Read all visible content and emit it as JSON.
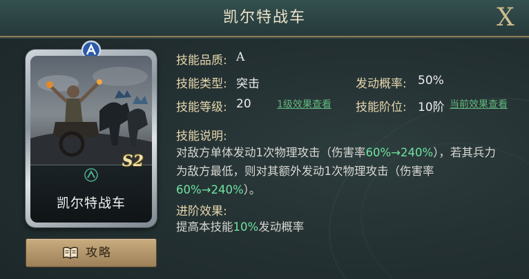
{
  "title": "凯尔特战车",
  "close_label": "X",
  "card": {
    "name": "凯尔特战车",
    "quality_badge": "A",
    "season": "S2"
  },
  "guide_button": {
    "label": "攻略",
    "icon": "book-icon"
  },
  "info": {
    "quality_label": "技能品质:",
    "quality_value": "A",
    "type_label": "技能类型:",
    "type_value": "突击",
    "prob_label": "发动概率:",
    "prob_value": "50%",
    "level_label": "技能等级:",
    "level_value": "20",
    "level_link": "1级效果查看",
    "tier_label": "技能阶位:",
    "tier_value": "10阶",
    "tier_link": "当前效果查看"
  },
  "description": {
    "heading": "技能说明:",
    "text_1": "对敌方单体发动1次物理攻击（伤害率",
    "hl_1": "60%→240%",
    "text_2": "），若其兵力为敌方最低，则对其额外发动1次物理攻击（伤害率",
    "hl_2": "60%→240%",
    "text_3": "）。"
  },
  "upgrade": {
    "heading": "进阶效果:",
    "text_1": "提高本技能",
    "hl_1": "10%",
    "text_2": "发动概率"
  },
  "colors": {
    "highlight": "#6fe3a0",
    "label": "#e6d7ad",
    "link": "#61b77d",
    "gold_border": "#8c7b55"
  }
}
